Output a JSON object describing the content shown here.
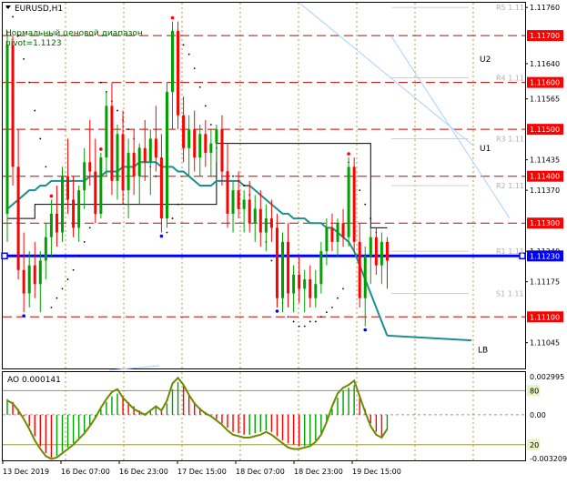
{
  "header": {
    "symbol": "EURUSD,H1",
    "line1": "Нормальный ценовой диапазон",
    "line2": "pivot=1.1123"
  },
  "ao_header": {
    "label": "AO 0.000141"
  },
  "colors": {
    "background": "#ffffff",
    "border": "#000000",
    "grid": "#9c9c3c",
    "bull": "#00a000",
    "bear": "#ff0000",
    "pivot": "#0000ff",
    "resistance": "#cc0000",
    "ma": "#1b8f8f",
    "channel_line": "#a8d0ff",
    "ao_line": "#6e8a00",
    "tick_label_bg": "#ff0000"
  },
  "chart_data": [
    {
      "type": "candlestick",
      "title": "EURUSD,H1",
      "ylim": [
        1.1099,
        1.1177
      ],
      "y_ticks": [
        "1.11760",
        "1.11700",
        "1.11640",
        "1.11600",
        "1.11565",
        "1.11500",
        "1.11435",
        "1.11400",
        "1.11370",
        "1.11300",
        "1.11240",
        "1.11230",
        "1.11175",
        "1.11100",
        "1.11045"
      ],
      "x_ticks": [
        "13 Dec 2019",
        "16 Dec 07:00",
        "16 Dec 23:00",
        "17 Dec 15:00",
        "18 Dec 07:00",
        "18 Dec 23:00",
        "19 Dec 15:00"
      ],
      "levels": [
        {
          "label": "1.11700",
          "value": 1.117,
          "style": "dashed-red"
        },
        {
          "label": "1.11600",
          "value": 1.116,
          "style": "dashed-red"
        },
        {
          "label": "1.11500",
          "value": 1.115,
          "style": "dashed-red"
        },
        {
          "label": "1.11400",
          "value": 1.114,
          "style": "dashed-red"
        },
        {
          "label": "1.11300",
          "value": 1.113,
          "style": "dashed-red"
        },
        {
          "label": "1.11230",
          "value": 1.1123,
          "style": "pivot-blue"
        },
        {
          "label": "1.11100",
          "value": 1.111,
          "style": "dashed-red"
        }
      ],
      "pivot_labels": [
        {
          "name": "R5 1.11",
          "value": 1.1176
        },
        {
          "name": "R4 1.11",
          "value": 1.1161
        },
        {
          "name": "R3 1.11",
          "value": 1.1148
        },
        {
          "name": "R2 1.11",
          "value": 1.1138
        },
        {
          "name": "R1 1.11",
          "value": 1.1124
        },
        {
          "name": "S1 1.11",
          "value": 1.1115
        }
      ],
      "annotations": [
        "U2",
        "U1",
        "LB"
      ],
      "candles": [
        {
          "o": 1.1132,
          "h": 1.1171,
          "l": 1.1126,
          "c": 1.1168
        },
        {
          "o": 1.1168,
          "h": 1.117,
          "l": 1.1138,
          "c": 1.1142
        },
        {
          "o": 1.1142,
          "h": 1.115,
          "l": 1.1118,
          "c": 1.112
        },
        {
          "o": 1.112,
          "h": 1.1128,
          "l": 1.1111,
          "c": 1.1115
        },
        {
          "o": 1.1115,
          "h": 1.1124,
          "l": 1.1112,
          "c": 1.1121
        },
        {
          "o": 1.1121,
          "h": 1.1126,
          "l": 1.1114,
          "c": 1.1117
        },
        {
          "o": 1.1117,
          "h": 1.1124,
          "l": 1.1111,
          "c": 1.1122
        },
        {
          "o": 1.1122,
          "h": 1.113,
          "l": 1.1118,
          "c": 1.1127
        },
        {
          "o": 1.1127,
          "h": 1.1135,
          "l": 1.1123,
          "c": 1.1132
        },
        {
          "o": 1.1132,
          "h": 1.1138,
          "l": 1.1125,
          "c": 1.1128
        },
        {
          "o": 1.1128,
          "h": 1.1142,
          "l": 1.1126,
          "c": 1.114
        },
        {
          "o": 1.114,
          "h": 1.1148,
          "l": 1.1132,
          "c": 1.1135
        },
        {
          "o": 1.1135,
          "h": 1.114,
          "l": 1.1127,
          "c": 1.1129
        },
        {
          "o": 1.1129,
          "h": 1.1138,
          "l": 1.1126,
          "c": 1.1137
        },
        {
          "o": 1.1137,
          "h": 1.1146,
          "l": 1.1133,
          "c": 1.1143
        },
        {
          "o": 1.1143,
          "h": 1.1152,
          "l": 1.1138,
          "c": 1.1141
        },
        {
          "o": 1.1141,
          "h": 1.1148,
          "l": 1.113,
          "c": 1.1132
        },
        {
          "o": 1.1132,
          "h": 1.1145,
          "l": 1.1131,
          "c": 1.1144
        },
        {
          "o": 1.1144,
          "h": 1.1158,
          "l": 1.114,
          "c": 1.1155
        },
        {
          "o": 1.1155,
          "h": 1.116,
          "l": 1.1136,
          "c": 1.1139
        },
        {
          "o": 1.1139,
          "h": 1.1151,
          "l": 1.1135,
          "c": 1.1149
        },
        {
          "o": 1.1149,
          "h": 1.1154,
          "l": 1.1134,
          "c": 1.1137
        },
        {
          "o": 1.1137,
          "h": 1.1148,
          "l": 1.1131,
          "c": 1.1145
        },
        {
          "o": 1.1145,
          "h": 1.115,
          "l": 1.1136,
          "c": 1.114
        },
        {
          "o": 1.114,
          "h": 1.1147,
          "l": 1.1134,
          "c": 1.1146
        },
        {
          "o": 1.1146,
          "h": 1.1152,
          "l": 1.1139,
          "c": 1.1143
        },
        {
          "o": 1.1143,
          "h": 1.115,
          "l": 1.1136,
          "c": 1.1148
        },
        {
          "o": 1.1148,
          "h": 1.1155,
          "l": 1.1141,
          "c": 1.1144
        },
        {
          "o": 1.1144,
          "h": 1.1149,
          "l": 1.1128,
          "c": 1.1131
        },
        {
          "o": 1.1131,
          "h": 1.116,
          "l": 1.1129,
          "c": 1.1158
        },
        {
          "o": 1.1158,
          "h": 1.1173,
          "l": 1.115,
          "c": 1.1171
        },
        {
          "o": 1.1171,
          "h": 1.1173,
          "l": 1.115,
          "c": 1.1153
        },
        {
          "o": 1.1153,
          "h": 1.1157,
          "l": 1.1143,
          "c": 1.1146
        },
        {
          "o": 1.1146,
          "h": 1.1153,
          "l": 1.114,
          "c": 1.115
        },
        {
          "o": 1.115,
          "h": 1.1154,
          "l": 1.1141,
          "c": 1.1144
        },
        {
          "o": 1.1144,
          "h": 1.1151,
          "l": 1.114,
          "c": 1.1149
        },
        {
          "o": 1.1149,
          "h": 1.1152,
          "l": 1.1142,
          "c": 1.1145
        },
        {
          "o": 1.1145,
          "h": 1.115,
          "l": 1.114,
          "c": 1.1147
        },
        {
          "o": 1.1147,
          "h": 1.1151,
          "l": 1.1143,
          "c": 1.115
        },
        {
          "o": 1.115,
          "h": 1.1153,
          "l": 1.1138,
          "c": 1.1141
        },
        {
          "o": 1.1141,
          "h": 1.1147,
          "l": 1.1129,
          "c": 1.1132
        },
        {
          "o": 1.1132,
          "h": 1.1139,
          "l": 1.1128,
          "c": 1.1137
        },
        {
          "o": 1.1137,
          "h": 1.1141,
          "l": 1.1131,
          "c": 1.1133
        },
        {
          "o": 1.1133,
          "h": 1.1137,
          "l": 1.1128,
          "c": 1.1135
        },
        {
          "o": 1.1135,
          "h": 1.1139,
          "l": 1.1128,
          "c": 1.113
        },
        {
          "o": 1.113,
          "h": 1.1136,
          "l": 1.1126,
          "c": 1.1133
        },
        {
          "o": 1.1133,
          "h": 1.1137,
          "l": 1.1125,
          "c": 1.1128
        },
        {
          "o": 1.1128,
          "h": 1.1134,
          "l": 1.1124,
          "c": 1.1131
        },
        {
          "o": 1.1131,
          "h": 1.1135,
          "l": 1.1126,
          "c": 1.1129
        },
        {
          "o": 1.1129,
          "h": 1.1132,
          "l": 1.1112,
          "c": 1.1114
        },
        {
          "o": 1.1114,
          "h": 1.1128,
          "l": 1.1111,
          "c": 1.1126
        },
        {
          "o": 1.1126,
          "h": 1.113,
          "l": 1.1112,
          "c": 1.1115
        },
        {
          "o": 1.1115,
          "h": 1.1121,
          "l": 1.1111,
          "c": 1.1119
        },
        {
          "o": 1.1119,
          "h": 1.1123,
          "l": 1.1113,
          "c": 1.1116
        },
        {
          "o": 1.1116,
          "h": 1.112,
          "l": 1.1111,
          "c": 1.1118
        },
        {
          "o": 1.1118,
          "h": 1.1121,
          "l": 1.1112,
          "c": 1.1114
        },
        {
          "o": 1.1114,
          "h": 1.112,
          "l": 1.1112,
          "c": 1.1117
        },
        {
          "o": 1.1117,
          "h": 1.1126,
          "l": 1.1115,
          "c": 1.1124
        },
        {
          "o": 1.1124,
          "h": 1.1131,
          "l": 1.1121,
          "c": 1.1129
        },
        {
          "o": 1.1129,
          "h": 1.1132,
          "l": 1.1124,
          "c": 1.1126
        },
        {
          "o": 1.1126,
          "h": 1.1131,
          "l": 1.1123,
          "c": 1.113
        },
        {
          "o": 1.113,
          "h": 1.1133,
          "l": 1.1125,
          "c": 1.1127
        },
        {
          "o": 1.1127,
          "h": 1.1144,
          "l": 1.1125,
          "c": 1.1142
        },
        {
          "o": 1.1142,
          "h": 1.1144,
          "l": 1.1124,
          "c": 1.1126
        },
        {
          "o": 1.1126,
          "h": 1.113,
          "l": 1.1112,
          "c": 1.1114
        },
        {
          "o": 1.1114,
          "h": 1.1125,
          "l": 1.1108,
          "c": 1.1123
        },
        {
          "o": 1.1123,
          "h": 1.1129,
          "l": 1.1117,
          "c": 1.1127
        },
        {
          "o": 1.1127,
          "h": 1.1129,
          "l": 1.1119,
          "c": 1.1121
        },
        {
          "o": 1.1121,
          "h": 1.1128,
          "l": 1.1117,
          "c": 1.1126
        },
        {
          "o": 1.1126,
          "h": 1.1127,
          "l": 1.1116,
          "c": 1.1122
        }
      ],
      "moving_average": [
        1.1133,
        1.1134,
        1.1135,
        1.1136,
        1.1137,
        1.1137,
        1.1138,
        1.1138,
        1.1139,
        1.1139,
        1.1139,
        1.1139,
        1.1139,
        1.1139,
        1.1139,
        1.114,
        1.114,
        1.114,
        1.1141,
        1.1141,
        1.1141,
        1.1142,
        1.1142,
        1.1142,
        1.1143,
        1.1143,
        1.1143,
        1.1143,
        1.1142,
        1.1142,
        1.1142,
        1.1141,
        1.1141,
        1.114,
        1.1139,
        1.1138,
        1.1138,
        1.1138,
        1.1139,
        1.1139,
        1.1139,
        1.1139,
        1.1139,
        1.1138,
        1.1138,
        1.1137,
        1.1136,
        1.1135,
        1.1134,
        1.1133,
        1.1132,
        1.1132,
        1.1131,
        1.1131,
        1.1131,
        1.113,
        1.113,
        1.113,
        1.1129,
        1.1129,
        1.1128,
        1.1127,
        1.1126,
        1.1124,
        1.1121,
        1.1118,
        1.1115,
        1.1112,
        1.1109,
        1.1106
      ],
      "parabolic_sar": [
        1.1176,
        1.1174,
        1.117,
        1.1165,
        1.116,
        1.1154,
        1.1148,
        1.1142,
        1.1112,
        1.1114,
        1.1116,
        1.1118,
        1.112,
        1.1123,
        1.1126,
        1.1129,
        1.1132,
        1.116,
        1.1158,
        1.1156,
        1.1154,
        1.1152,
        1.115,
        1.1148,
        1.1146,
        1.1144,
        1.1142,
        1.114,
        1.1138,
        1.1128,
        1.1131,
        1.1134,
        1.1168,
        1.1166,
        1.1163,
        1.1159,
        1.1155,
        1.1151,
        1.1146,
        1.1142,
        1.1141,
        1.114,
        1.1139,
        1.1138,
        1.1136,
        1.1133,
        1.113,
        1.1126,
        1.1122,
        1.1117,
        1.1113,
        1.111,
        1.1109,
        1.1108,
        1.1108,
        1.1109,
        1.1109,
        1.111,
        1.1111,
        1.1112,
        1.1114,
        1.1116,
        1.1143,
        1.114,
        1.1137,
        1.1134,
        1.1131,
        1.1128,
        1.1125,
        1.1123
      ],
      "pivot_step_line": [
        1.1131,
        1.1131,
        1.1131,
        1.1131,
        1.1131,
        1.1134,
        1.1134,
        1.1134,
        1.1134,
        1.1134,
        1.1134,
        1.1134,
        1.1134,
        1.1134,
        1.1134,
        1.1134,
        1.1134,
        1.1134,
        1.1134,
        1.1134,
        1.1134,
        1.1134,
        1.1134,
        1.1134,
        1.1134,
        1.1134,
        1.1134,
        1.1134,
        1.1134,
        1.1134,
        1.1134,
        1.1134,
        1.1134,
        1.1134,
        1.1134,
        1.1134,
        1.1134,
        1.1134,
        1.1147,
        1.1147,
        1.1147,
        1.1147,
        1.1147,
        1.1147,
        1.1147,
        1.1147,
        1.1147,
        1.1147,
        1.1147,
        1.1147,
        1.1147,
        1.1147,
        1.1147,
        1.1147,
        1.1147,
        1.1147,
        1.1147,
        1.1147,
        1.1147,
        1.1147,
        1.1147,
        1.1147,
        1.1147,
        1.1147,
        1.1147,
        1.1147,
        1.1129,
        1.1129,
        1.1129,
        1.1129
      ]
    },
    {
      "type": "bar",
      "title": "AO 0.000141",
      "ylim": [
        -0.0032,
        0.003
      ],
      "y_ticks": [
        "0.002995",
        "80",
        "0.00",
        "20",
        "-0.003209"
      ],
      "levels": [
        {
          "label": "80",
          "value": 0.0017
        },
        {
          "label": "20",
          "value": -0.0021
        }
      ],
      "values": [
        0.0011,
        0.0009,
        0.0004,
        -0.0001,
        -0.0008,
        -0.0015,
        -0.0022,
        -0.0027,
        -0.003,
        -0.0029,
        -0.0026,
        -0.0023,
        -0.002,
        -0.0016,
        -0.0012,
        -0.0007,
        -0.0002,
        0.0004,
        0.0009,
        0.0013,
        0.0015,
        0.0013,
        0.0009,
        0.0006,
        0.0003,
        0.0001,
        0.0003,
        0.0005,
        0.0004,
        0.0008,
        0.0018,
        0.0023,
        0.002,
        0.0014,
        0.0009,
        0.0005,
        0.0002,
        0.0,
        -0.0003,
        -0.0006,
        -0.0009,
        -0.0012,
        -0.0013,
        -0.0014,
        -0.0014,
        -0.0013,
        -0.0012,
        -0.0011,
        -0.0012,
        -0.0015,
        -0.0018,
        -0.002,
        -0.0021,
        -0.0022,
        -0.0022,
        -0.0021,
        -0.0018,
        -0.0013,
        -0.0006,
        0.0004,
        0.0012,
        0.0017,
        0.0019,
        0.0021,
        0.0014,
        0.0004,
        -0.0006,
        -0.0012,
        -0.0015,
        -0.0011
      ],
      "line": [
        0.001,
        0.0008,
        0.0003,
        -0.0003,
        -0.001,
        -0.0018,
        -0.0024,
        -0.0029,
        -0.0031,
        -0.003,
        -0.0027,
        -0.0024,
        -0.0021,
        -0.0017,
        -0.0013,
        -0.0008,
        -0.0002,
        0.0005,
        0.0011,
        0.0016,
        0.0018,
        0.0012,
        0.0008,
        0.0004,
        0.0002,
        0.0,
        0.0003,
        0.0006,
        0.0003,
        0.001,
        0.0022,
        0.0026,
        0.0021,
        0.0014,
        0.0008,
        0.0004,
        0.0001,
        -0.0001,
        -0.0004,
        -0.0007,
        -0.0011,
        -0.0014,
        -0.0015,
        -0.0016,
        -0.0016,
        -0.0015,
        -0.0014,
        -0.0012,
        -0.0014,
        -0.0017,
        -0.002,
        -0.0023,
        -0.0024,
        -0.0024,
        -0.0023,
        -0.0022,
        -0.0019,
        -0.0014,
        -0.0005,
        0.0006,
        0.0015,
        0.0019,
        0.0021,
        0.0024,
        0.0013,
        0.0002,
        -0.0008,
        -0.0014,
        -0.0016,
        -0.001
      ]
    }
  ]
}
